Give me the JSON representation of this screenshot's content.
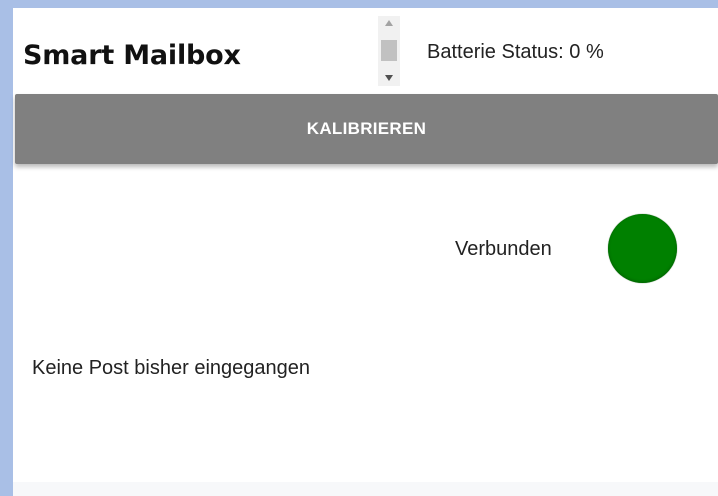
{
  "header": {
    "title": "Smart Mailbox",
    "battery_label": "Batterie Status: 0 %"
  },
  "actions": {
    "calibrate_label": "KALIBRIEREN"
  },
  "connection": {
    "label": "Verbunden",
    "indicator_color": "#008000"
  },
  "mail": {
    "status_text": "Keine Post bisher eingegangen"
  },
  "colors": {
    "button_background": "#808080",
    "page_background": "#ffffff",
    "outer_background": "#a9bfe6"
  }
}
